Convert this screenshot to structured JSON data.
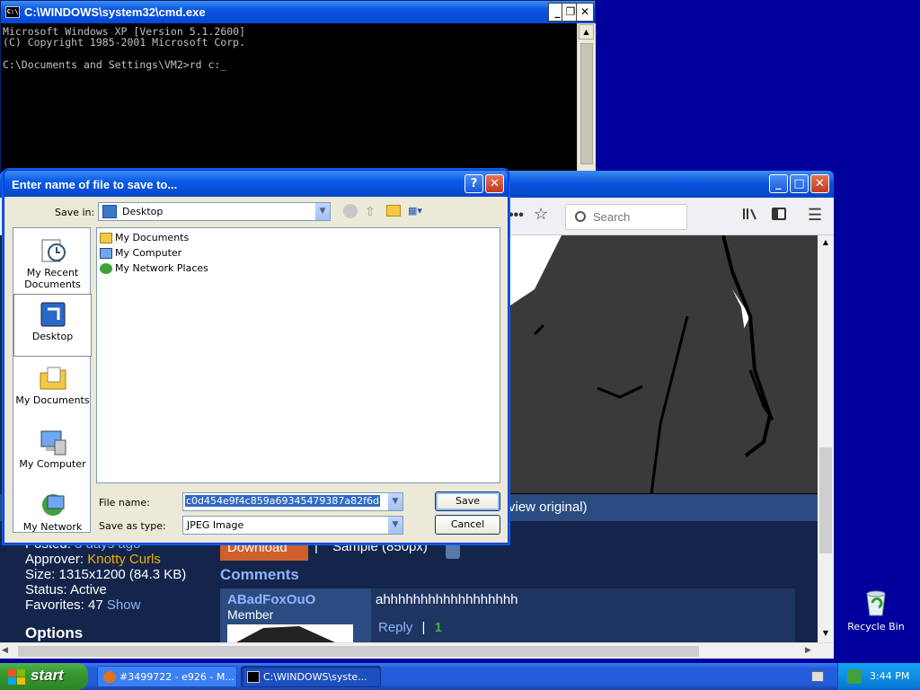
{
  "cmd": {
    "title": "C:\\WINDOWS\\system32\\cmd.exe",
    "icon_text": "C:\\",
    "line1": "Microsoft Windows XP [Version 5.1.2600]",
    "line2": "(C) Copyright 1985-2001 Microsoft Corp.",
    "line3": "",
    "line4": "C:\\Documents and Settings\\VM2>rd c:"
  },
  "browser": {
    "search_placeholder": "Search",
    "icons": [
      "more-icon",
      "bookmark-star-icon",
      "library-icon",
      "sidebar-icon",
      "menu-icon"
    ],
    "view_original": "view original)",
    "posted": "Posted:",
    "posted_value": "3 days ago",
    "approver_label": "Approver:",
    "approver_value": "Knotty Curls",
    "size": "Size: 1315x1200 (84.3 KB)",
    "status": "Status: Active",
    "favorites_label": "Favorites: 47",
    "favorites_link": "Show",
    "options_heading": "Options",
    "download_label": "Download",
    "separator": "|",
    "sample_label": "Sample (850px)",
    "comments_heading": "Comments",
    "comment": {
      "author": "ABadFoxOuO",
      "role": "Member",
      "text": "ahhhhhhhhhhhhhhhhhh",
      "reply": "Reply",
      "sep": "|",
      "score": "1"
    }
  },
  "dialog": {
    "title": "Enter name of file to save to...",
    "save_in_label": "Save in:",
    "save_in_value": "Desktop",
    "places": [
      "My Recent Documents",
      "Desktop",
      "My Documents",
      "My Computer",
      "My Network"
    ],
    "files": [
      "My Documents",
      "My Computer",
      "My Network Places"
    ],
    "file_name_label": "File name:",
    "file_name_value": "c0d454e9f4c859a69345479387a82f6d",
    "save_as_type_label": "Save as type:",
    "save_as_type_value": "JPEG Image",
    "save_button": "Save",
    "cancel_button": "Cancel"
  },
  "desktop": {
    "recycle_bin": "Recycle Bin"
  },
  "taskbar": {
    "start": "start",
    "tasks": [
      "#3499722 - e926 - M...",
      "C:\\WINDOWS\\syste..."
    ],
    "clock": "3:44 PM"
  },
  "colors": {
    "xp_blue": "#0a54e0",
    "start_green": "#37962f",
    "page_bg": "#14244a",
    "download_orange": "#d0602a"
  }
}
